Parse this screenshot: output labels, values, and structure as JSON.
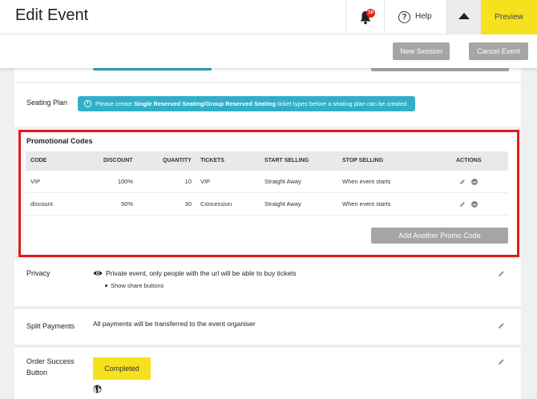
{
  "header": {
    "title": "Edit Event",
    "notification_count": "10",
    "help_label": "Help",
    "preview_label": "Preview",
    "new_session_label": "New Session",
    "cancel_event_label": "Cancel Event"
  },
  "seating_plan": {
    "label": "Seating Plan",
    "info_prefix": "Please create ",
    "info_bold": "Single Reserved Seating/Group Reserved Seating",
    "info_suffix": " ticket types before a seating plan can be created"
  },
  "promo_codes": {
    "title": "Promotional Codes",
    "columns": [
      "CODE",
      "DISCOUNT",
      "QUANTITY",
      "TICKETS",
      "START SELLING",
      "STOP SELLING",
      "ACTIONS"
    ],
    "rows": [
      {
        "code": "VIP",
        "discount": "100%",
        "quantity": "10",
        "tickets": "VIP",
        "start": "Straight Away",
        "stop": "When event starts"
      },
      {
        "code": "discount",
        "discount": "50%",
        "quantity": "30",
        "tickets": "Concession",
        "start": "Straight Away",
        "stop": "When event starts"
      }
    ],
    "add_button_label": "Add Another Promo Code"
  },
  "privacy": {
    "label": "Privacy",
    "text": "Private event, only people with the url will be able to buy tickets",
    "bullet": "Show share buttons"
  },
  "split_payments": {
    "label": "Split Payments",
    "text": "All payments will be transferred to the event organiser"
  },
  "order_success": {
    "label_line1": "Order Success",
    "label_line2": "Button",
    "button_label": "Completed"
  },
  "colors": {
    "accent_yellow": "#f7e01d",
    "info_blue": "#31afc9",
    "highlight_red": "#e41b1b",
    "button_gray": "#a5a5a5"
  },
  "icons": [
    "bell-icon",
    "help-circle-icon",
    "caret-up-icon",
    "info-icon",
    "pencil-icon",
    "remove-icon",
    "eye-icon",
    "globe-icon"
  ]
}
